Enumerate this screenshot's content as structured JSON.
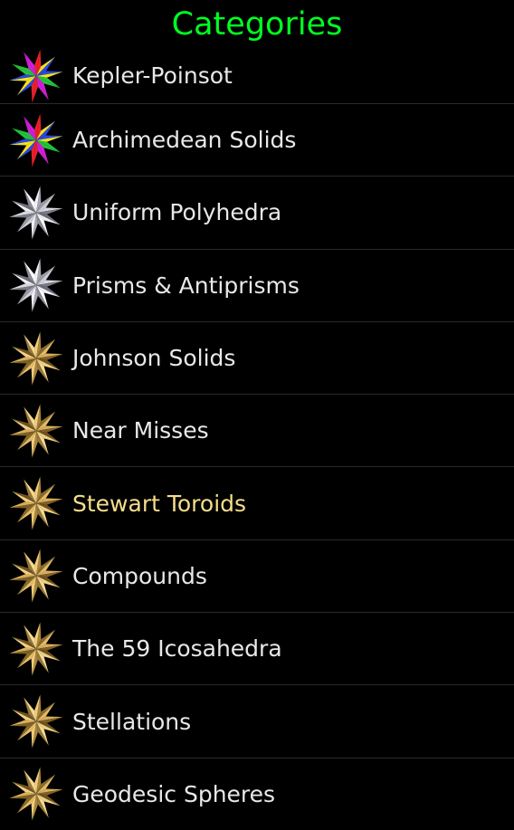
{
  "header": {
    "title": "Categories",
    "title_color": "#00ff22"
  },
  "colors": {
    "background": "#000000",
    "item_text": "#e8e8e8",
    "highlight_text": "#f5de8a",
    "divider": "#2a2a2a"
  },
  "items": [
    {
      "label": "Kepler-Poinsot",
      "icon": "multicolor-star-polyhedron-icon",
      "highlighted": false
    },
    {
      "label": "Archimedean Solids",
      "icon": "multicolor-star-polyhedron-icon",
      "highlighted": false
    },
    {
      "label": "Uniform Polyhedra",
      "icon": "silver-star-polyhedron-icon",
      "highlighted": false
    },
    {
      "label": "Prisms & Antiprisms",
      "icon": "silver-star-polyhedron-icon",
      "highlighted": false
    },
    {
      "label": "Johnson Solids",
      "icon": "gold-star-polyhedron-icon",
      "highlighted": false
    },
    {
      "label": "Near Misses",
      "icon": "gold-star-polyhedron-icon",
      "highlighted": false
    },
    {
      "label": "Stewart Toroids",
      "icon": "gold-star-polyhedron-icon",
      "highlighted": true
    },
    {
      "label": "Compounds",
      "icon": "gold-star-polyhedron-icon",
      "highlighted": false
    },
    {
      "label": "The 59 Icosahedra",
      "icon": "gold-star-polyhedron-icon",
      "highlighted": false
    },
    {
      "label": "Stellations",
      "icon": "gold-star-polyhedron-icon",
      "highlighted": false
    },
    {
      "label": "Geodesic Spheres",
      "icon": "gold-star-polyhedron-icon",
      "highlighted": false
    }
  ]
}
